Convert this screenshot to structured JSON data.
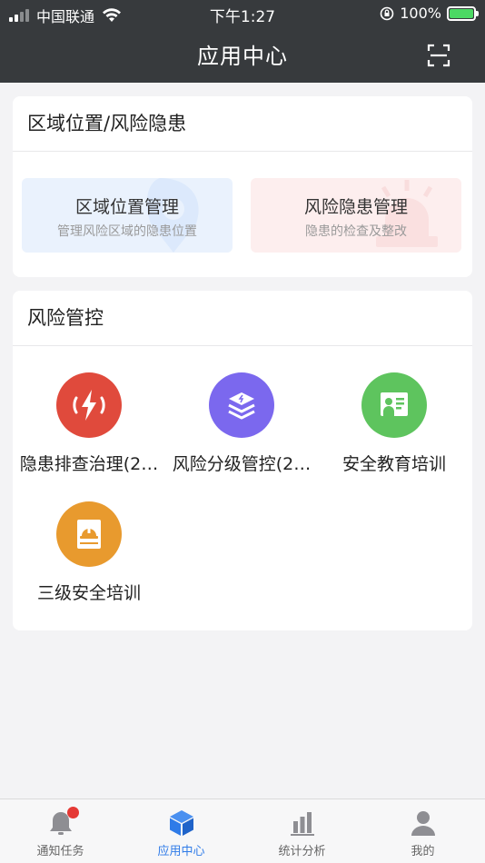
{
  "status_bar": {
    "carrier": "中国联通",
    "time": "下午1:27",
    "battery_percent": "100%"
  },
  "header": {
    "title": "应用中心",
    "scan_icon": "scan-icon"
  },
  "section_area": {
    "title": "区域位置/风险隐患",
    "tiles": [
      {
        "title": "区域位置管理",
        "subtitle": "管理风险区域的隐患位置",
        "icon": "location-icon",
        "color": "#eaf2fd"
      },
      {
        "title": "风险隐患管理",
        "subtitle": "隐患的检查及整改",
        "icon": "alarm-icon",
        "color": "#fdeeee"
      }
    ]
  },
  "section_risk": {
    "title": "风险管控",
    "apps": [
      {
        "label": "隐患排查治理(2…",
        "icon": "lightning-icon",
        "color": "#e04a3c"
      },
      {
        "label": "风险分级管控(2…",
        "icon": "layers-icon",
        "color": "#7b68ee"
      },
      {
        "label": "安全教育培训",
        "icon": "presentation-icon",
        "color": "#5ec45e"
      },
      {
        "label": "三级安全培训",
        "icon": "helmet-book-icon",
        "color": "#e89a2e"
      }
    ]
  },
  "tabbar": {
    "tabs": [
      {
        "label": "通知任务",
        "icon": "bell-icon",
        "active": false,
        "has_badge": true
      },
      {
        "label": "应用中心",
        "icon": "cube-icon",
        "active": true
      },
      {
        "label": "统计分析",
        "icon": "bar-chart-icon",
        "active": false
      },
      {
        "label": "我的",
        "icon": "person-icon",
        "active": false
      }
    ]
  },
  "colors": {
    "header_bg": "#373a3d",
    "accent": "#2f7be8",
    "page_bg": "#f3f3f5"
  }
}
